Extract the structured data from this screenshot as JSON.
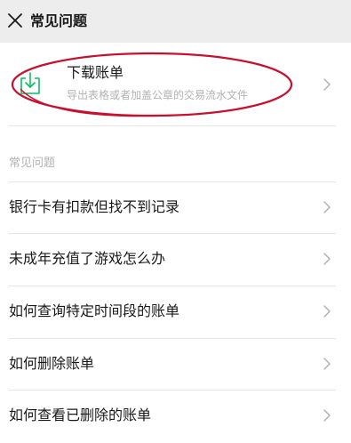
{
  "header": {
    "close_icon": "close-icon",
    "title": "常见问题"
  },
  "download_card": {
    "icon": "download-icon",
    "title": "下载账单",
    "subtitle": "导出表格或者加盖公章的交易流水文件",
    "annotation_color": "#c8102e"
  },
  "faq_section": {
    "label": "常见问题",
    "items": [
      {
        "label": "银行卡有扣款但找不到记录"
      },
      {
        "label": "未成年充值了游戏怎么办"
      },
      {
        "label": "如何查询特定时间段的账单"
      },
      {
        "label": "如何删除账单"
      },
      {
        "label": "如何查看已删除的账单"
      }
    ]
  },
  "colors": {
    "accent_green": "#07c160",
    "header_bg": "#ededed",
    "secondary_text": "#b2b2b2"
  }
}
